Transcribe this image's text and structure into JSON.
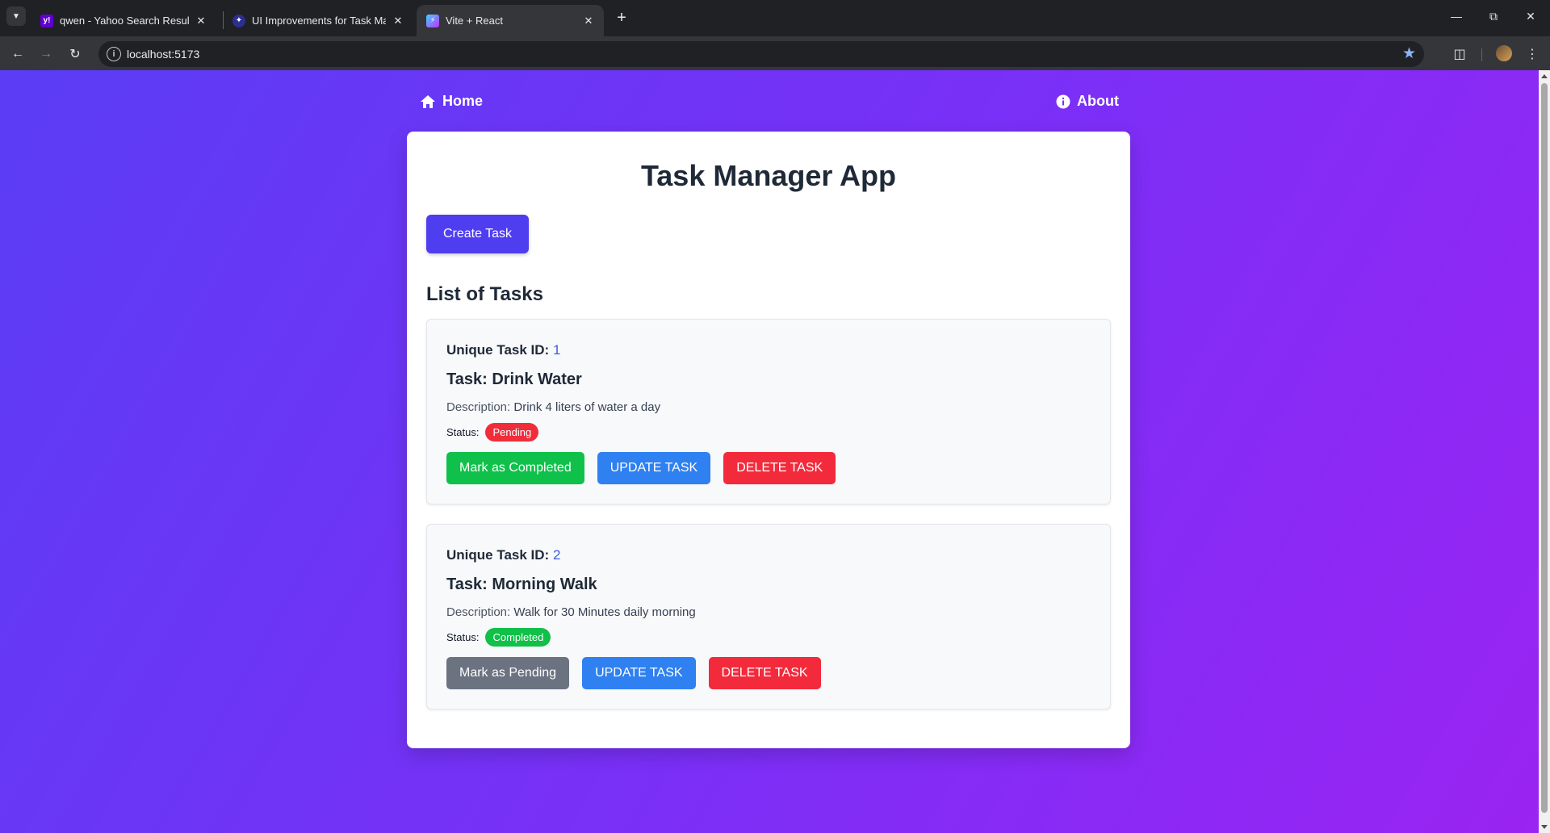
{
  "browser": {
    "tabs": [
      {
        "title": "qwen - Yahoo Search Results",
        "favicon": "yahoo-icon",
        "active": false
      },
      {
        "title": "UI Improvements for Task Mana",
        "favicon": "app-icon",
        "active": false
      },
      {
        "title": "Vite + React",
        "favicon": "vite-icon",
        "active": true
      }
    ],
    "url": "localhost:5173"
  },
  "nav": {
    "home": "Home",
    "about": "About"
  },
  "app": {
    "title": "Task Manager App",
    "create_button": "Create Task",
    "list_heading": "List of Tasks",
    "id_label": "Unique Task ID:",
    "description_label": "Description:",
    "status_label": "Status:"
  },
  "tasks": [
    {
      "id": "1",
      "name": "Task: Drink Water",
      "description": "Drink 4 liters of water a day",
      "status": "Pending",
      "toggle_label": "Mark as Completed",
      "update_label": "UPDATE TASK",
      "delete_label": "DELETE TASK"
    },
    {
      "id": "2",
      "name": "Task: Morning Walk",
      "description": "Walk for 30 Minutes daily morning",
      "status": "Completed",
      "toggle_label": "Mark as Pending",
      "update_label": "UPDATE TASK",
      "delete_label": "DELETE TASK"
    }
  ],
  "colors": {
    "primary": "#4f3df0",
    "pending": "#ef2d3b",
    "completed": "#10c048",
    "update": "#2f80f0",
    "delete": "#f22a3c"
  }
}
